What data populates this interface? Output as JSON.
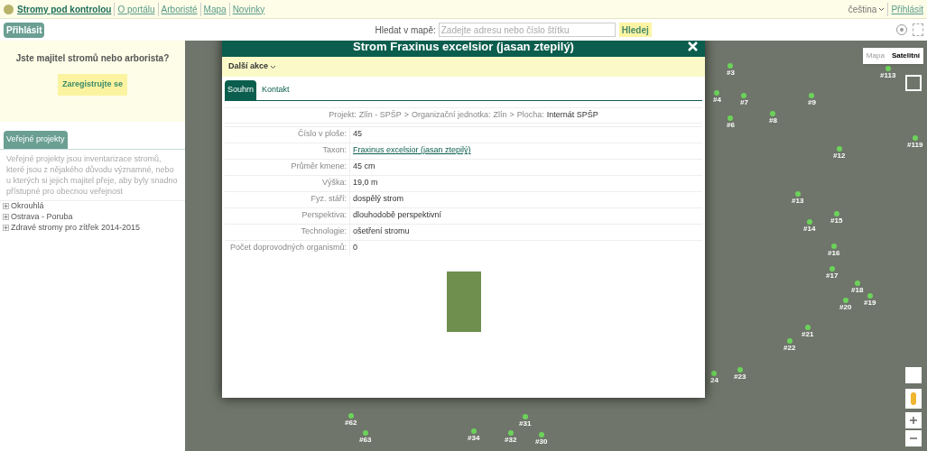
{
  "top_bar": {
    "site_title": "Stromy pod kontrolou",
    "links": [
      "O portálu",
      "Arboristé",
      "Mapa",
      "Novinky"
    ],
    "language": "čeština",
    "login_link": "Přihlásit"
  },
  "toolbar": {
    "login_button": "Přihlásit",
    "search_label": "Hledat v mapě:",
    "search": {
      "placeholder": "Zadejte adresu nebo číslo štítku"
    },
    "search_button": "Hledej"
  },
  "sidebar": {
    "promo_title": "Jste majitel stromů nebo arborista?",
    "register_button": "Zaregistrujte se",
    "tab": "Veřejné projekty",
    "description": "Veřejné projekty jsou inventarizace stromů, které jsou z nějakého důvodu významné, nebo u kterých si jejich majitel přeje, aby byly snadno přístupné pro obecnou veřejnost",
    "items": [
      {
        "label": "Okrouhlá",
        "expanded": false
      },
      {
        "label": "Ostrava - Poruba",
        "expanded": false
      },
      {
        "label": "Zdravé stromy pro zítřek 2014-2015",
        "expanded": false
      }
    ]
  },
  "map": {
    "types": [
      {
        "label": "Mapa",
        "selected": false
      },
      {
        "label": "Satelitní",
        "selected": true
      }
    ],
    "markers": [
      "#3",
      "#113",
      "#4",
      "#7",
      "#9",
      "#6",
      "#8",
      "#119",
      "#12",
      "#13",
      "#14",
      "#15",
      "#16",
      "#17",
      "#18",
      "#19",
      "#20",
      "#21",
      "#22",
      "#23",
      "24",
      "#62",
      "#31",
      "#63",
      "#34",
      "#32",
      "#30"
    ]
  },
  "dialog": {
    "title": "Strom Fraxinus excelsior (jasan ztepilý)",
    "actions_menu": "Další akce",
    "tabs": [
      {
        "label": "Souhrn",
        "selected": true
      },
      {
        "label": "Kontakt",
        "selected": false
      }
    ],
    "breadcrumb_separator": ">",
    "breadcrumb": [
      {
        "label": "Projekt:",
        "value": "Zlín - SPŠP"
      },
      {
        "label": "Organizační jednotka:",
        "value": "Zlín"
      },
      {
        "label": "Plocha:",
        "value": "Internát SPŠP"
      }
    ],
    "fields": [
      {
        "label": "Číslo v ploše:",
        "value": "45",
        "kind": "text"
      },
      {
        "label": "Taxon:",
        "value": "Fraxinus excelsior (jasan ztepilý)",
        "kind": "link"
      },
      {
        "label": "Průměr kmene:",
        "value": "45 cm",
        "kind": "text"
      },
      {
        "label": "Výška:",
        "value": "19,0 m",
        "kind": "text"
      },
      {
        "label": "Fyz. stáří:",
        "value": "dospělý strom",
        "kind": "text"
      },
      {
        "label": "Perspektiva:",
        "value": "dlouhodobě perspektivní",
        "kind": "text"
      },
      {
        "label": "Technologie:",
        "value": "ošetření stromu",
        "kind": "text"
      },
      {
        "label": "Počet doprovodných organismů:",
        "value": "0",
        "kind": "text"
      }
    ]
  }
}
